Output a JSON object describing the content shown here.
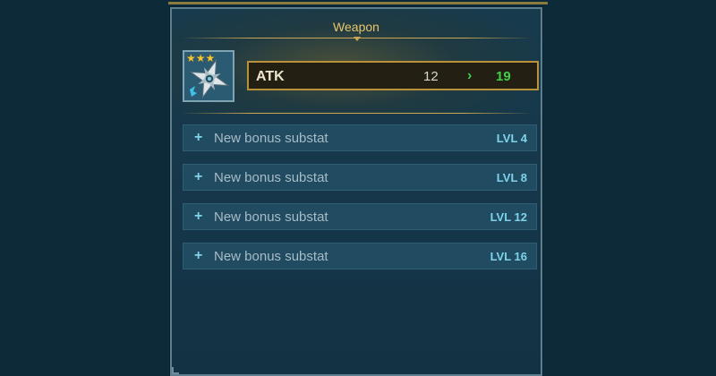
{
  "panel": {
    "title": "Weapon"
  },
  "item": {
    "icon": "shuriken-icon",
    "stars": 3,
    "star_glyphs": [
      "★",
      "★",
      "★"
    ]
  },
  "main_stat": {
    "name": "ATK",
    "current": "12",
    "arrow": "›",
    "next": "19"
  },
  "substats": [
    {
      "plus": "+",
      "label": "New bonus substat",
      "level": "LVL 4"
    },
    {
      "plus": "+",
      "label": "New bonus substat",
      "level": "LVL 8"
    },
    {
      "plus": "+",
      "label": "New bonus substat",
      "level": "LVL 12"
    },
    {
      "plus": "+",
      "label": "New bonus substat",
      "level": "LVL 16"
    }
  ],
  "colors": {
    "background": "#0c2a38",
    "panel": "#16384a",
    "gold": "#c9a655",
    "green": "#3fd04a",
    "cyan": "#7fd3ec",
    "row": "#204b61"
  }
}
